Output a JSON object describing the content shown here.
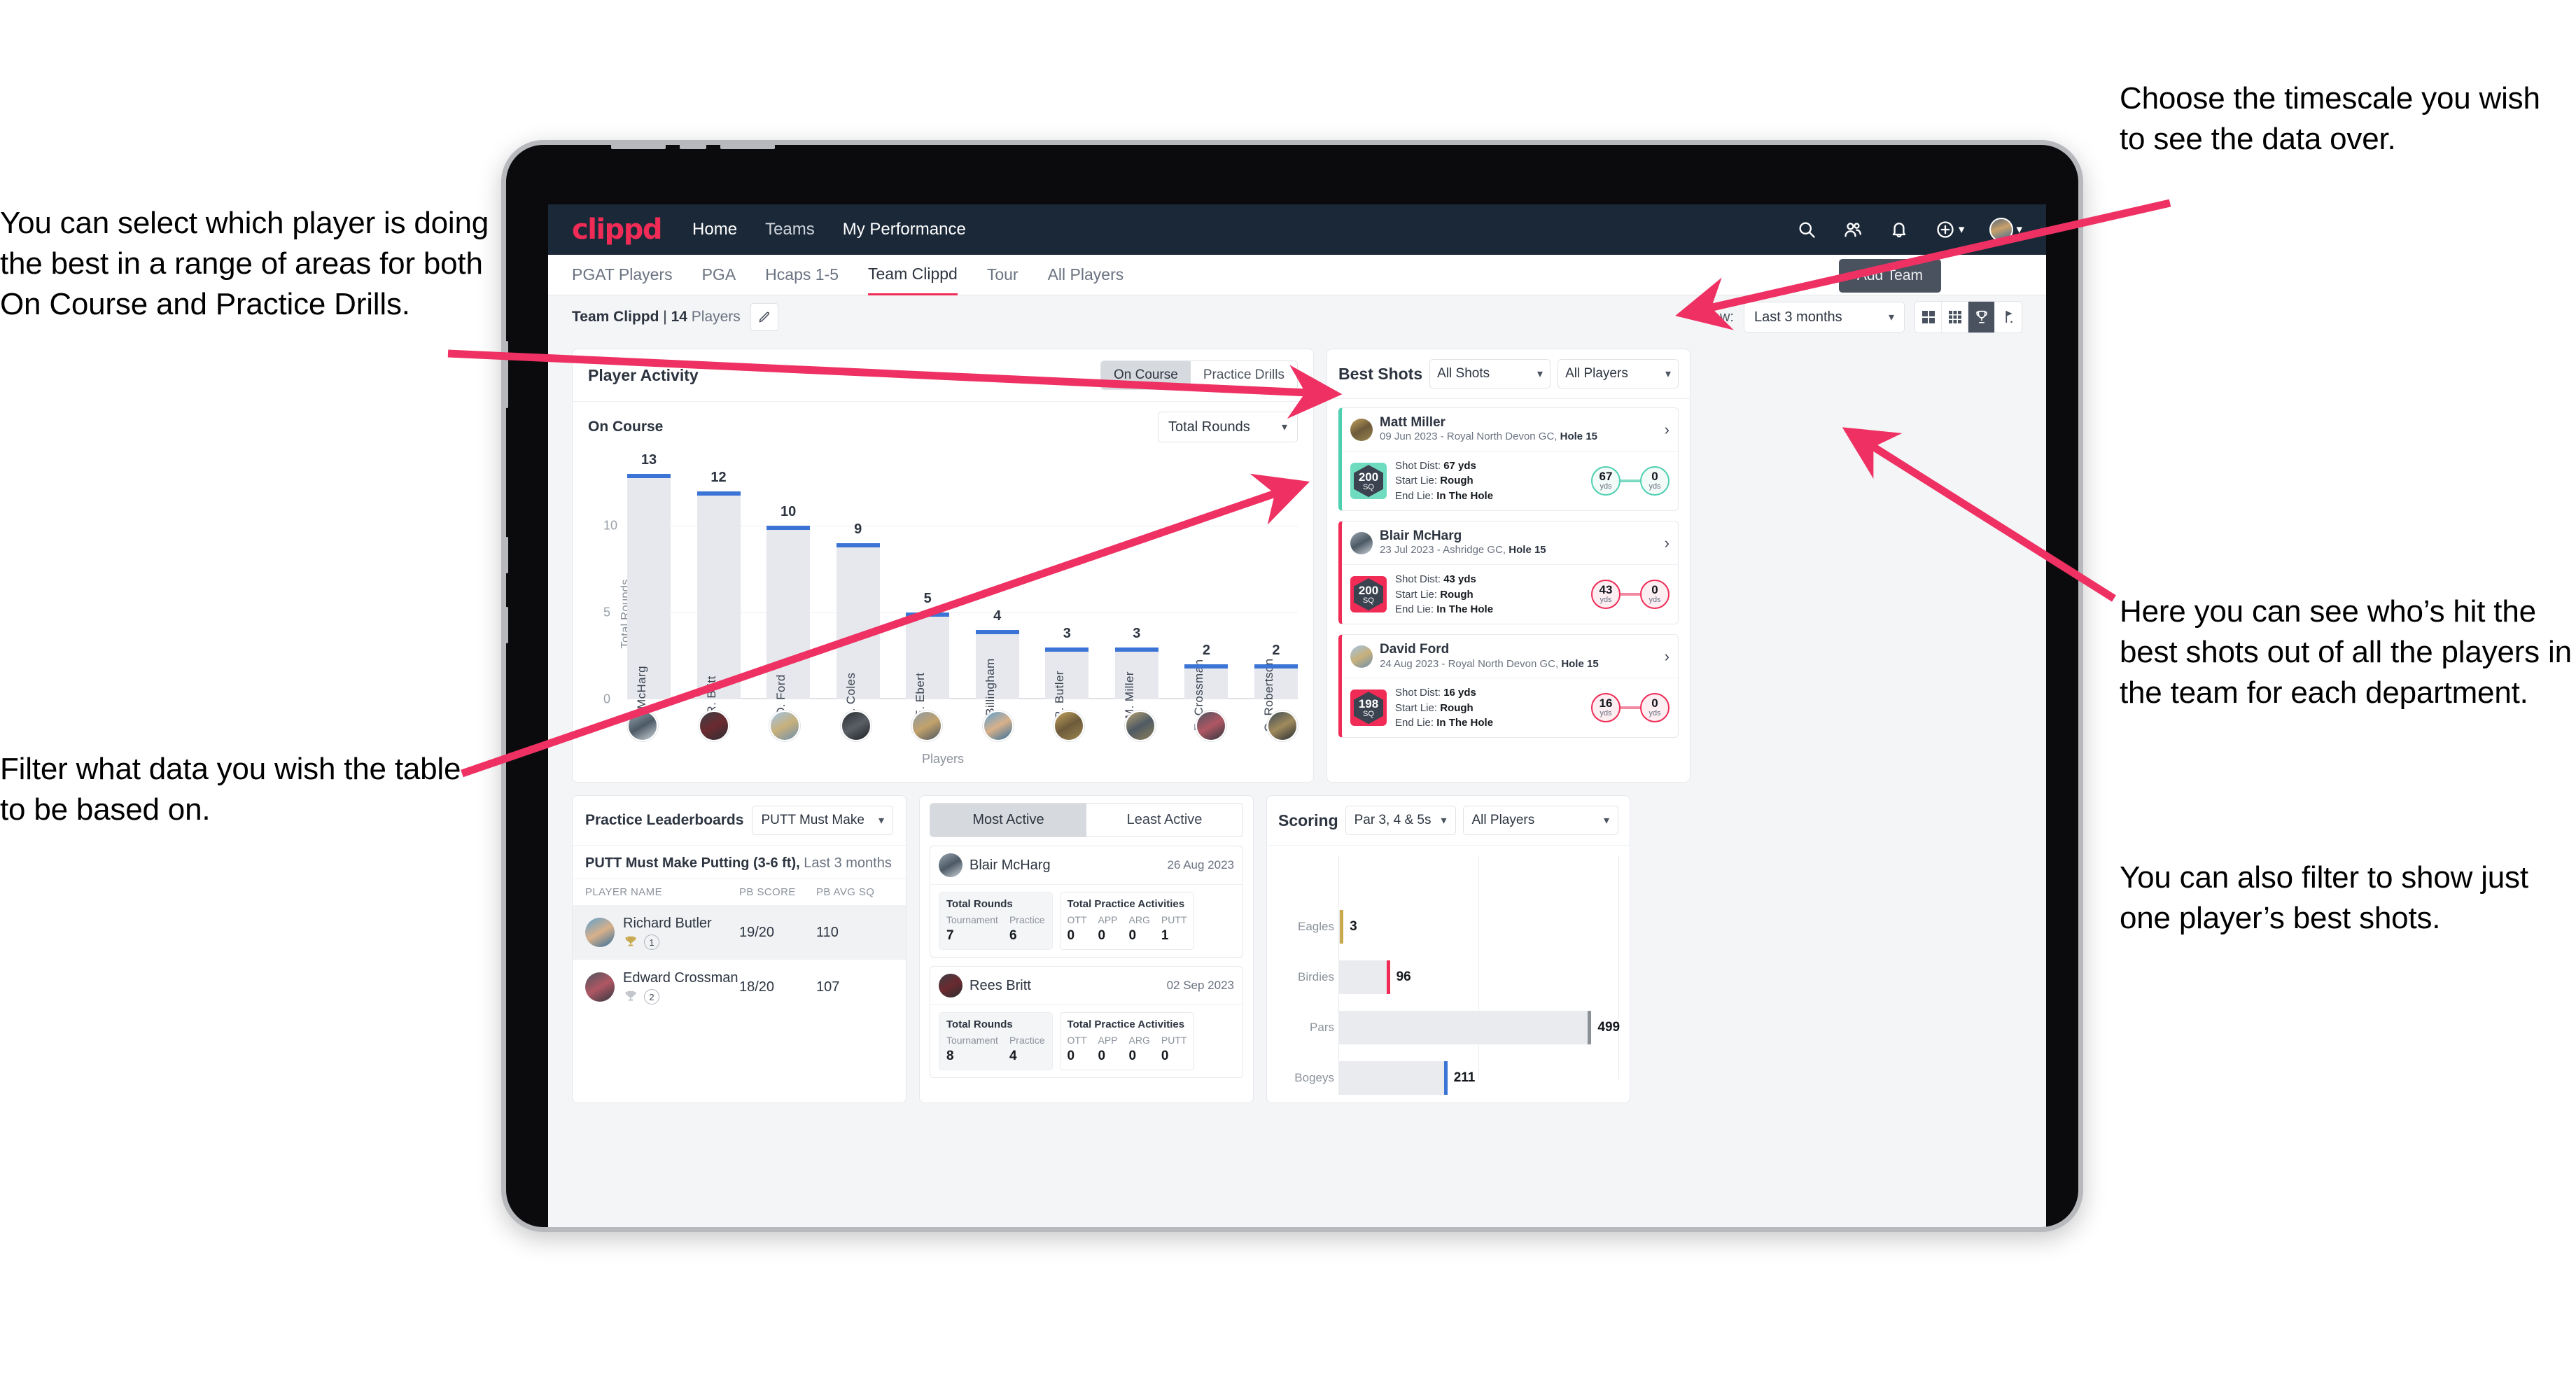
{
  "annotations": {
    "left_top": "You can select which player is doing the best in a range of areas for both On Course and Practice Drills.",
    "left_bottom": "Filter what data you wish the table to be based on.",
    "right_top": "Choose the timescale you wish to see the data over.",
    "right_middle": "Here you can see who’s hit the best shots out of all the players in the team for each department.",
    "right_bottom": "You can also filter to show just one player’s best shots."
  },
  "navbar": {
    "logo": "clippd",
    "links": [
      {
        "label": "Home",
        "active": true
      },
      {
        "label": "Teams",
        "active": false
      },
      {
        "label": "My Performance",
        "active": true
      }
    ],
    "icons": [
      "search-icon",
      "people-icon",
      "bell-icon",
      "plus-circle-icon",
      "avatar"
    ]
  },
  "tabs": [
    {
      "label": "PGAT Players",
      "active": false
    },
    {
      "label": "PGA",
      "active": false
    },
    {
      "label": "Hcaps 1-5",
      "active": false
    },
    {
      "label": "Team Clippd",
      "active": true
    },
    {
      "label": "Tour",
      "active": false
    },
    {
      "label": "All Players",
      "active": false
    }
  ],
  "add_team_button": "Add Team",
  "subheader": {
    "team_name": "Team Clippd",
    "separator": " | ",
    "player_count": "14",
    "players_word": "Players",
    "edit_icon": "pencil-icon",
    "show_label": "Show:",
    "timescale_value": "Last 3 months",
    "view_toggles": [
      {
        "icon": "grid-4-icon",
        "active": false
      },
      {
        "icon": "grid-9-icon",
        "active": false
      },
      {
        "icon": "trophy-icon",
        "active": true
      },
      {
        "icon": "golf-flag-icon",
        "active": false
      }
    ]
  },
  "player_activity": {
    "title": "Player Activity",
    "segments": [
      {
        "label": "On Course",
        "active": true
      },
      {
        "label": "Practice Drills",
        "active": false
      }
    ],
    "sub_label": "On Course",
    "metric_select": "Total Rounds"
  },
  "chart_data": [
    {
      "type": "bar",
      "title": "Player Activity",
      "xlabel": "Players",
      "ylabel": "Total Rounds",
      "ylim": [
        0,
        14
      ],
      "yticks": [
        0,
        5,
        10
      ],
      "grid": true,
      "categories": [
        "B. McHarg",
        "R. Britt",
        "D. Ford",
        "J. Coles",
        "E. Ebert",
        "D. Billingham",
        "R. Butler",
        "M. Miller",
        "E. Crossman",
        "C. Robertson"
      ],
      "values": [
        13,
        12,
        10,
        9,
        5,
        4,
        3,
        3,
        2,
        2
      ]
    },
    {
      "type": "bar",
      "orientation": "horizontal",
      "title": "Scoring",
      "categories": [
        "Eagles",
        "Birdies",
        "Pars",
        "Bogeys"
      ],
      "values": [
        3,
        96,
        499,
        211
      ],
      "xlim": [
        0,
        560
      ],
      "colors": [
        "#c9a94e",
        "#ef2b56",
        "#8a9199",
        "#3b74d4"
      ]
    }
  ],
  "best_shots": {
    "title": "Best Shots",
    "shot_filter": "All Shots",
    "player_filter": "All Players",
    "shots": [
      {
        "player": "Matt Miller",
        "meta_date": "09 Jun 2023 - Royal North Devon GC, ",
        "meta_hole": "Hole 15",
        "sq": "200",
        "sq_unit": "SQ",
        "shot_dist_label": "Shot Dist: ",
        "shot_dist": "67 yds",
        "start_lie_label": "Start Lie: ",
        "start_lie": "Rough",
        "end_lie_label": "End Lie: ",
        "end_lie": "In The Hole",
        "from_value": "67",
        "from_unit": "yds",
        "to_value": "0",
        "to_unit": "yds",
        "accent": "teal"
      },
      {
        "player": "Blair McHarg",
        "meta_date": "23 Jul 2023 - Ashridge GC, ",
        "meta_hole": "Hole 15",
        "sq": "200",
        "sq_unit": "SQ",
        "shot_dist_label": "Shot Dist: ",
        "shot_dist": "43 yds",
        "start_lie_label": "Start Lie: ",
        "start_lie": "Rough",
        "end_lie_label": "End Lie: ",
        "end_lie": "In The Hole",
        "from_value": "43",
        "from_unit": "yds",
        "to_value": "0",
        "to_unit": "yds",
        "accent": "pink"
      },
      {
        "player": "David Ford",
        "meta_date": "24 Aug 2023 - Royal North Devon GC, ",
        "meta_hole": "Hole 15",
        "sq": "198",
        "sq_unit": "SQ",
        "shot_dist_label": "Shot Dist: ",
        "shot_dist": "16 yds",
        "start_lie_label": "Start Lie: ",
        "start_lie": "Rough",
        "end_lie_label": "End Lie: ",
        "end_lie": "In The Hole",
        "from_value": "16",
        "from_unit": "yds",
        "to_value": "0",
        "to_unit": "yds",
        "accent": "pink"
      }
    ]
  },
  "practice_leaderboards": {
    "title": "Practice Leaderboards",
    "drill_select": "PUTT Must Make Putting ...",
    "subtitle_bold": "PUTT Must Make Putting (3-6 ft),",
    "subtitle_muted": " Last 3 months",
    "columns": [
      "PLAYER NAME",
      "PB SCORE",
      "PB AVG SQ"
    ],
    "rows": [
      {
        "name": "Richard Butler",
        "rank": "1",
        "trophy": "gold",
        "pb_score": "19/20",
        "pb_avg_sq": "110",
        "highlight": true
      },
      {
        "name": "Edward Crossman",
        "rank": "2",
        "trophy": "silver",
        "pb_score": "18/20",
        "pb_avg_sq": "107",
        "highlight": false
      }
    ]
  },
  "activity": {
    "tabs": [
      {
        "label": "Most Active",
        "active": true
      },
      {
        "label": "Least Active",
        "active": false
      }
    ],
    "cards": [
      {
        "player": "Blair McHarg",
        "date": "26 Aug 2023",
        "rounds_title": "Total Rounds",
        "rounds": [
          {
            "key": "Tournament",
            "value": "7"
          },
          {
            "key": "Practice",
            "value": "6"
          }
        ],
        "practice_title": "Total Practice Activities",
        "practice": [
          {
            "key": "OTT",
            "value": "0"
          },
          {
            "key": "APP",
            "value": "0"
          },
          {
            "key": "ARG",
            "value": "0"
          },
          {
            "key": "PUTT",
            "value": "1"
          }
        ]
      },
      {
        "player": "Rees Britt",
        "date": "02 Sep 2023",
        "rounds_title": "Total Rounds",
        "rounds": [
          {
            "key": "Tournament",
            "value": "8"
          },
          {
            "key": "Practice",
            "value": "4"
          }
        ],
        "practice_title": "Total Practice Activities",
        "practice": [
          {
            "key": "OTT",
            "value": "0"
          },
          {
            "key": "APP",
            "value": "0"
          },
          {
            "key": "ARG",
            "value": "0"
          },
          {
            "key": "PUTT",
            "value": "0"
          }
        ]
      }
    ]
  },
  "scoring": {
    "title": "Scoring",
    "par_filter": "Par 3, 4 & 5s",
    "player_filter": "All Players"
  },
  "colors": {
    "brand_pink": "#ef2b56",
    "navbar": "#1b2838",
    "bar_blue": "#3b74d4",
    "bar_fill": "#e6e8ed",
    "teal": "#4ecfb0",
    "gold": "#c9a94e"
  }
}
